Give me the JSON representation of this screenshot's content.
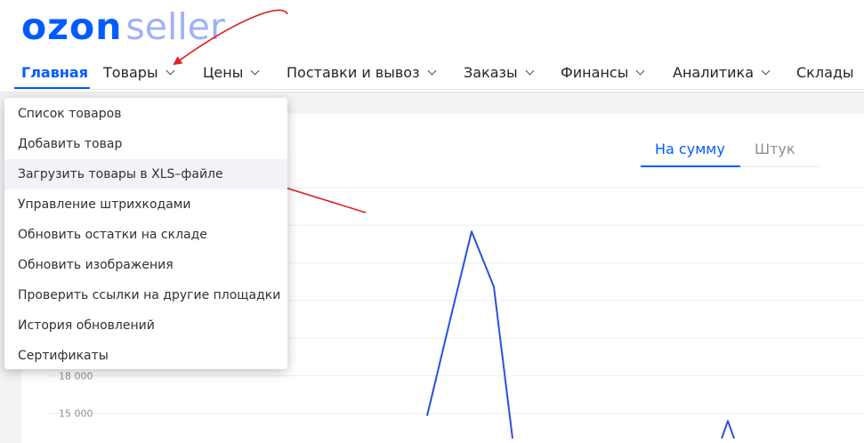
{
  "logo": {
    "part1": "ozon",
    "part2": "seller"
  },
  "nav": {
    "items": [
      {
        "label": "Главная",
        "dropdown": false,
        "active": true
      },
      {
        "label": "Товары",
        "dropdown": true
      },
      {
        "label": "Цены",
        "dropdown": true
      },
      {
        "label": "Поставки и вывоз",
        "dropdown": true
      },
      {
        "label": "Заказы",
        "dropdown": true
      },
      {
        "label": "Финансы",
        "dropdown": true
      },
      {
        "label": "Аналитика",
        "dropdown": true
      },
      {
        "label": "Склады",
        "dropdown": false
      }
    ]
  },
  "dropdown": {
    "items": [
      "Список товаров",
      "Добавить товар",
      "Загрузить товары в XLS–файле",
      "Управление штрихкодами",
      "Обновить остатки на складе",
      "Обновить изображения",
      "Проверить ссылки на другие площадки",
      "История обновлений",
      "Сертификаты"
    ],
    "highlighted_index": 2
  },
  "chart_tabs": {
    "sum": "На сумму",
    "qty": "Штук",
    "active": "sum"
  },
  "chart_data": {
    "type": "line",
    "y_ticks": [
      "18 000",
      "15 000"
    ],
    "series": [
      {
        "color": "#2b50e0",
        "values": [
          13000,
          14800,
          22200,
          29500,
          25100,
          13000,
          null,
          null,
          null,
          13000,
          14400,
          13000
        ]
      }
    ]
  },
  "colors": {
    "brand": "#005bff",
    "annotation_arrow": "#e0211f"
  }
}
